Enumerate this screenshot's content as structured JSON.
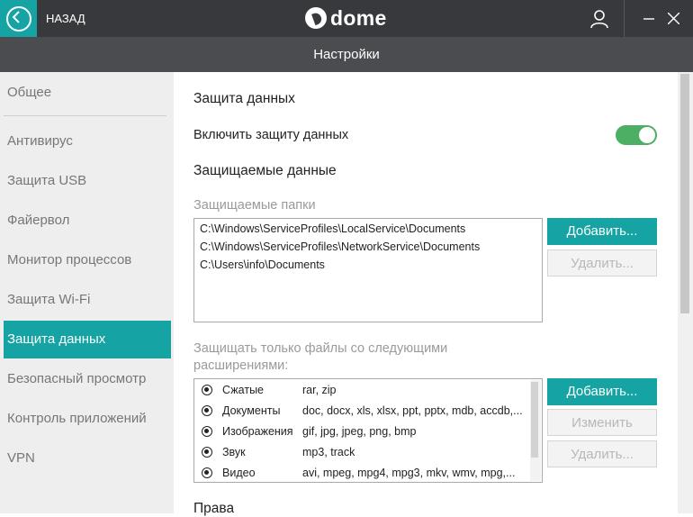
{
  "header": {
    "back_label": "НАЗАД",
    "logo_text": "dome",
    "title": "Настройки"
  },
  "sidebar": {
    "items": [
      {
        "label": "Общее"
      },
      {
        "label": "Антивирус"
      },
      {
        "label": "Защита USB"
      },
      {
        "label": "Файервол"
      },
      {
        "label": "Монитор процессов"
      },
      {
        "label": "Защита Wi-Fi"
      },
      {
        "label": "Защита данных"
      },
      {
        "label": "Безопасный просмотр"
      },
      {
        "label": "Контроль приложений"
      },
      {
        "label": "VPN"
      }
    ],
    "active_index": 6
  },
  "main": {
    "section_title": "Защита данных",
    "enable_label": "Включить защиту данных",
    "enable_on": true,
    "protected_title": "Защищаемые данные",
    "folders_label": "Защищаемые папки",
    "folders": [
      "C:\\Windows\\ServiceProfiles\\LocalService\\Documents",
      "C:\\Windows\\ServiceProfiles\\NetworkService\\Documents",
      "C:\\Users\\info\\Documents"
    ],
    "add_label": "Добавить...",
    "remove_label": "Удалить...",
    "extensions_label_line1": "Защищать только файлы со следующими",
    "extensions_label_line2": "расширениями:",
    "extensions": [
      {
        "name": "Сжатые",
        "values": "rar, zip"
      },
      {
        "name": "Документы",
        "values": "doc, docx, xls, xlsx, ppt, pptx, mdb, accdb,..."
      },
      {
        "name": "Изображения",
        "values": "gif, jpg, jpeg, png, bmp"
      },
      {
        "name": "Звук",
        "values": "mp3, track"
      },
      {
        "name": "Видео",
        "values": "avi, mpeg, mpg4, mpg3, mkv, wmv, mpg,..."
      }
    ],
    "ext_add_label": "Добавить...",
    "ext_edit_label": "Изменить",
    "ext_remove_label": "Удалить...",
    "rights_title": "Права"
  },
  "colors": {
    "accent": "#15a3a3",
    "toggle_on": "#4caf63",
    "titlebar": "#37393c",
    "subbar": "#4a4c50"
  }
}
